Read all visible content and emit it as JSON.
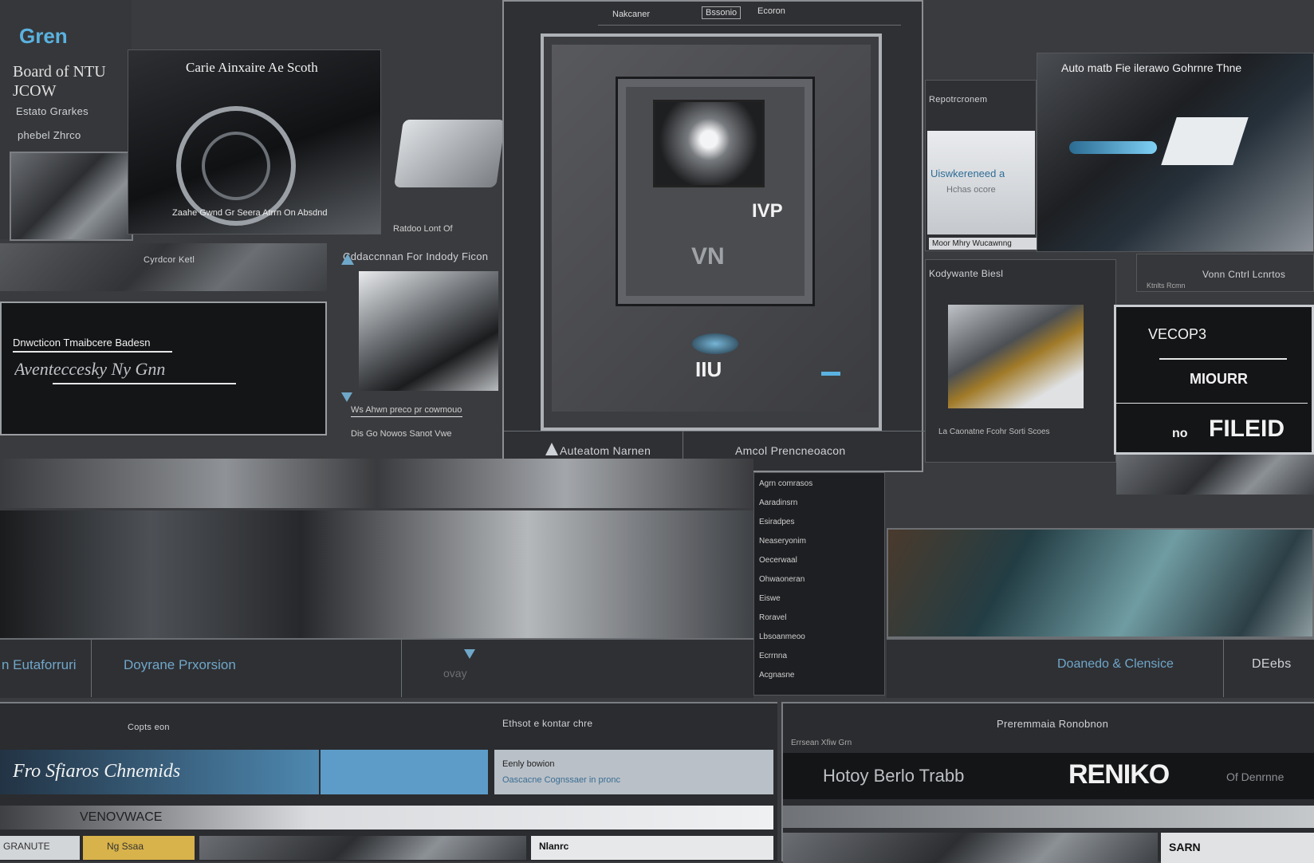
{
  "brand": {
    "logo": "Gren",
    "tagline": "Board of NTU JCOW",
    "sub1": "Estato Grarkes",
    "sub2": "phebel Zhrco"
  },
  "left_top": {
    "title": "Carie Ainxaire Ae Scoth",
    "caption": "Ratdoo Lont Of",
    "overlay": "Zaahe Gwnd Gr Seera Atrrn On Absdnd"
  },
  "mid_left": {
    "label1": "Cyrdcor Ketl",
    "label2": "Cddaccnnan For Indody Ficon"
  },
  "dark_card": {
    "title": "Dnwcticon Tmaibcere Badesn",
    "script": "Aventeccesky Ny Gnn",
    "foot1": "Ws Ahwn preco pr cowmouo",
    "foot2": "Dis Go Nowos Sanot Vwe"
  },
  "center": {
    "left_label": "Auteatom Narnen",
    "right_label": "Amcol Prencneoacon",
    "device_mark": "IVP",
    "device_logo": "VN",
    "base_logo": "IIU",
    "tabs": [
      "Nakcaner",
      "Bssonio",
      "Ecoron"
    ]
  },
  "right_top": {
    "label": "Repotrcronem",
    "banner": "Auto matb Fie ilerawo Gohrnre Thne",
    "card_title": "Uiswkereneed a",
    "card_sub": "Hchas ocore",
    "caption": "Moor Mhry Wucawnng"
  },
  "right_mid": {
    "label": "Kodywante Biesl",
    "label2": "Vonn Cntrl Lcnrtos",
    "sub": "Ktnlts Rcmn",
    "caption": "La Caonatne Fcohr Sorti Scoes"
  },
  "promo": {
    "l1": "VECOP3",
    "l2": "MIOURR",
    "l3": "FILEID",
    "prefix": "no"
  },
  "mid_band": {
    "left": "n Eutaforruri",
    "center": "Doyrane Prxorsion",
    "center_icon": "ovay",
    "right": "Doanedo & Clensice",
    "far_right": "DEebs"
  },
  "list_panel": {
    "items": [
      "Agrn comrasos",
      "Aaradinsrn",
      "Esiradpes",
      "Neaseryonim",
      "Oecerwaal",
      "Ohwaoneran",
      "Eiswe",
      "Roravel",
      "Lbsoanmeoo",
      "Ecrrnna",
      "Acgnasne"
    ]
  },
  "bottom": {
    "left_label": "Copts eon",
    "center_label": "Ethsot e kontar chre",
    "script": "Fro Sfiaros Chnemids",
    "side_title": "Eenly bowion",
    "side_sub": "Oascacne Cognssaer in pronc",
    "right_title": "Preremmaia Ronobnon",
    "right_sub": "Errsean Xfiw Grn",
    "strip": "Hotoy Berlo Trabb",
    "strip_logo": "RENIKO",
    "strip_tail": "Of Denrnne",
    "menu": "VENOVWACE",
    "chip1": "GRANUTE",
    "chip2": "Ng Ssaa",
    "chip3": "Nlanrc",
    "chip4": "SARN"
  },
  "colors": {
    "bg": "#3a3b3e",
    "panel": "#2b2c2f",
    "accent": "#6fa7c9",
    "blue_bar": "#4e88b0"
  }
}
